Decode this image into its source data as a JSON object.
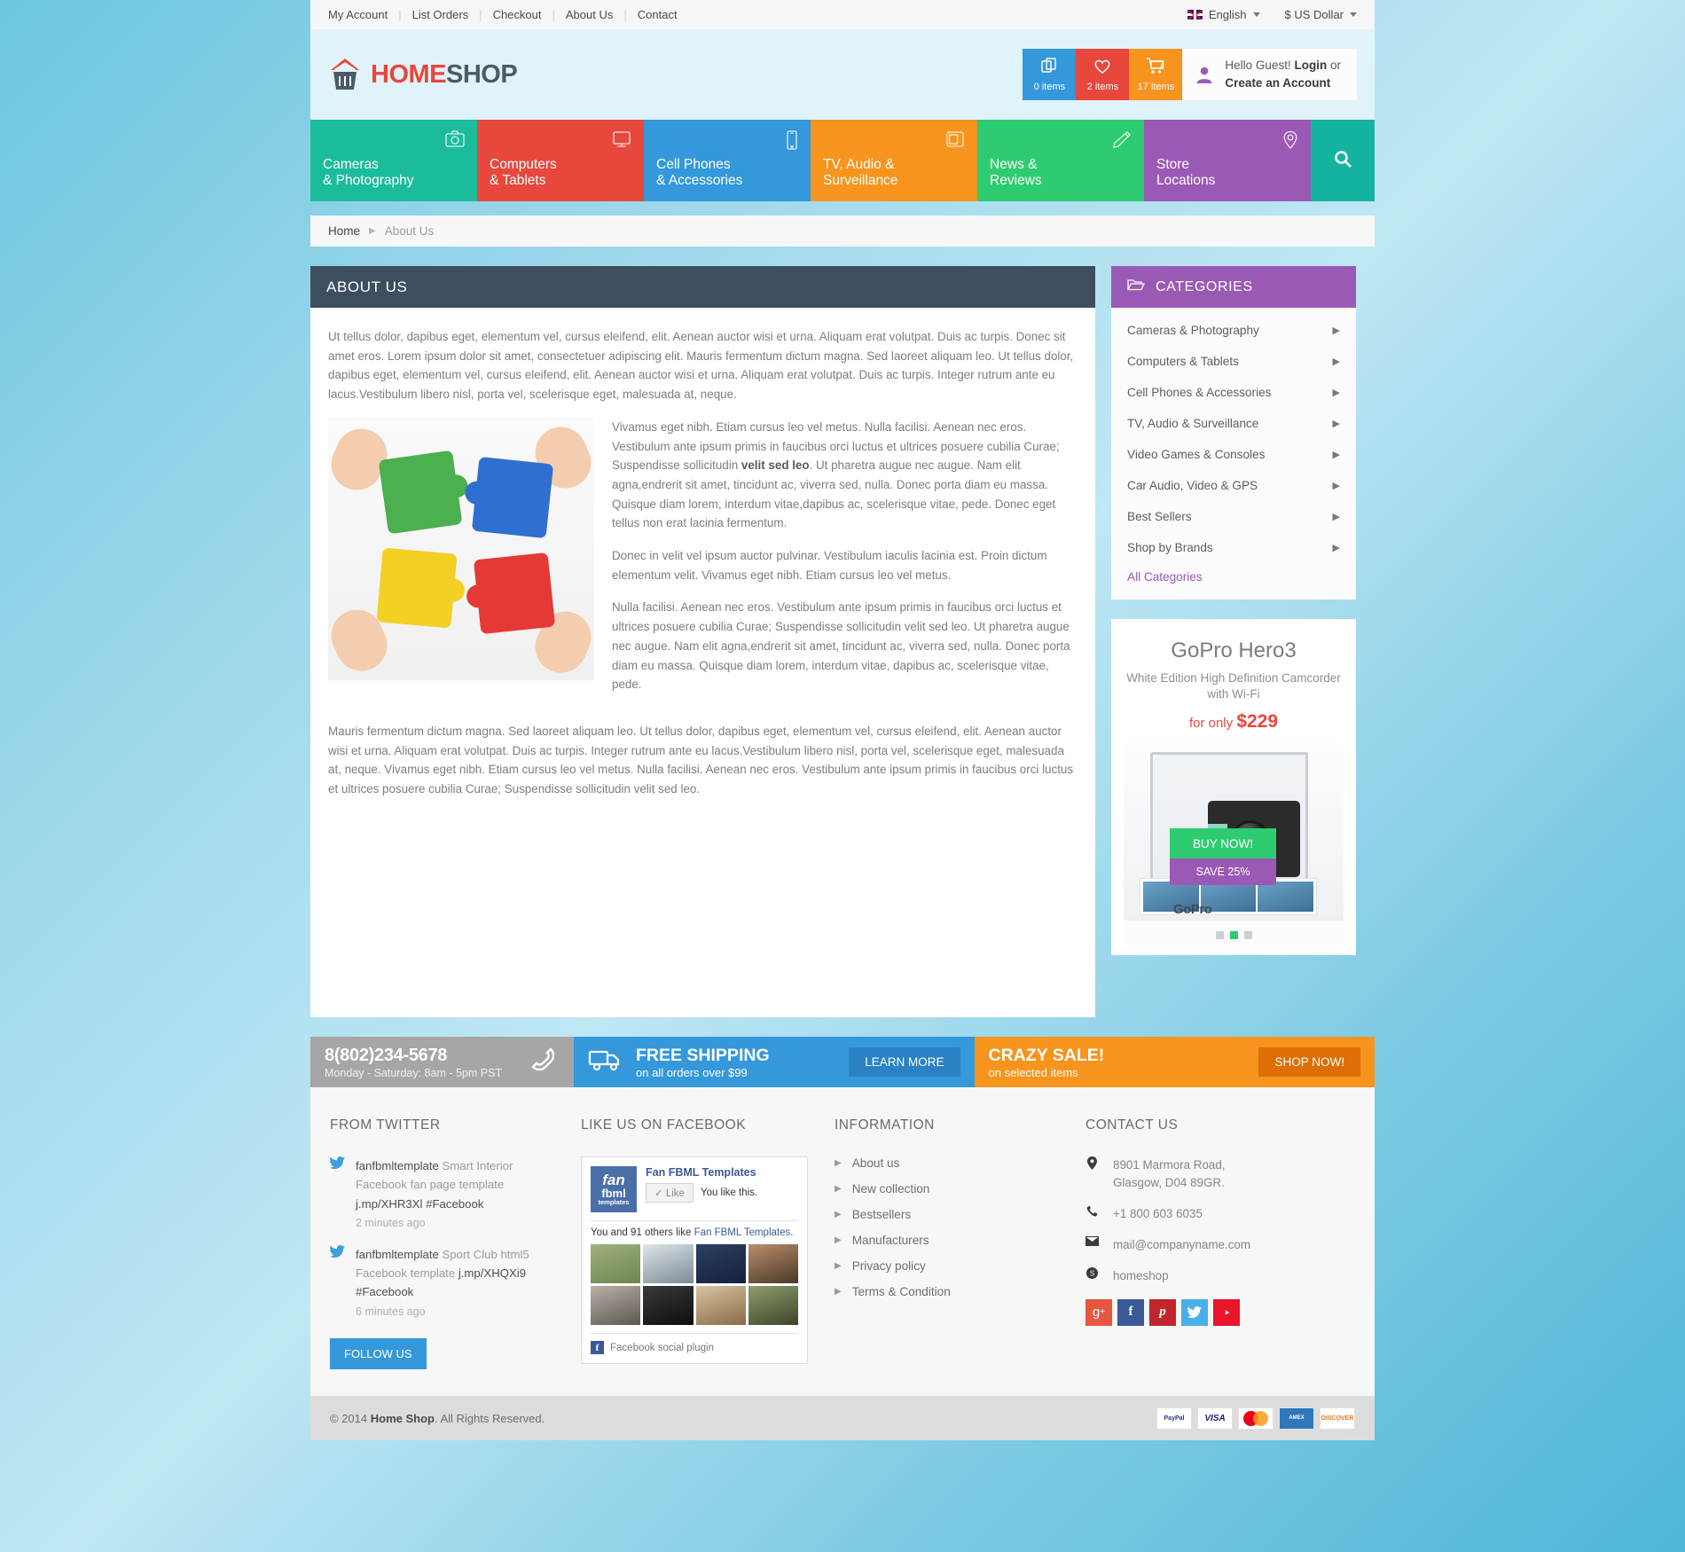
{
  "topbar": {
    "links": [
      "My Account",
      "List Orders",
      "Checkout",
      "About Us",
      "Contact"
    ],
    "language": "English",
    "currency": "$ US Dollar"
  },
  "header": {
    "logo_home": "HOME",
    "logo_shop": "SHOP",
    "tools": [
      {
        "icon": "compare-icon",
        "count": "0 items",
        "name": "compare"
      },
      {
        "icon": "heart-icon",
        "count": "2 items",
        "name": "wishlist"
      },
      {
        "icon": "cart-icon",
        "count": "17 items",
        "name": "cart"
      }
    ],
    "greeting": "Hello Guest!",
    "login": "Login",
    "or": " or",
    "create_account": "Create an Account"
  },
  "mainnav": {
    "items": [
      {
        "line1": "Cameras",
        "line2": "& Photography",
        "icon": "camera-icon",
        "color": "#1abc9c"
      },
      {
        "line1": "Computers",
        "line2": "& Tablets",
        "icon": "monitor-icon",
        "color": "#e8473c"
      },
      {
        "line1": "Cell Phones",
        "line2": "& Accessories",
        "icon": "phone-icon",
        "color": "#3498db"
      },
      {
        "line1": "TV, Audio &",
        "line2": "Surveillance",
        "icon": "tv-icon",
        "color": "#f7941e"
      },
      {
        "line1": "News &",
        "line2": "Reviews",
        "icon": "pencil-icon",
        "color": "#2ecc71"
      },
      {
        "line1": "Store",
        "line2": "Locations",
        "icon": "map-pin-icon",
        "color": "#9b59b6"
      }
    ],
    "search_icon": "search-icon"
  },
  "breadcrumb": {
    "home": "Home",
    "current": "About Us"
  },
  "main": {
    "title": "ABOUT US",
    "paragraph1": "Ut tellus dolor, dapibus eget, elementum vel, cursus eleifend, elit. Aenean auctor wisi et urna. Aliquam erat volutpat. Duis ac turpis. Donec sit amet eros. Lorem ipsum dolor sit amet, consectetuer adipiscing elit. Mauris fermentum dictum magna. Sed laoreet aliquam leo. Ut tellus dolor, dapibus eget, elementum vel, cursus eleifend, elit. Aenean auctor wisi et urna. Aliquam erat volutpat. Duis ac turpis. Integer rutrum ante eu lacus.Vestibulum libero nisl, porta vel, scelerisque eget, malesuada at, neque.",
    "paragraph2_a": "Vivamus eget nibh. Etiam cursus leo vel metus. Nulla facilisi. Aenean nec eros. Vestibulum ante ipsum primis in faucibus orci luctus et ultrices posuere cubilia Curae; Suspendisse sollicitudin ",
    "paragraph2_bold": "velit sed leo",
    "paragraph2_b": ". Ut pharetra augue nec augue. Nam elit agna,endrerit sit amet, tincidunt ac, viverra sed, nulla. Donec porta diam eu massa. Quisque diam lorem, interdum vitae,dapibus ac, scelerisque vitae, pede. Donec eget tellus non erat lacinia fermentum.",
    "paragraph3": "Donec in velit vel ipsum auctor pulvinar. Vestibulum iaculis lacinia est. Proin dictum elementum velit.  Vivamus eget nibh. Etiam cursus leo vel metus.",
    "paragraph4": "Nulla facilisi. Aenean nec eros. Vestibulum ante ipsum primis in faucibus orci luctus et ultrices posuere cubilia Curae; Suspendisse sollicitudin velit sed leo. Ut pharetra augue nec augue. Nam elit agna,endrerit sit amet, tincidunt ac, viverra sed, nulla. Donec porta diam eu massa. Quisque diam lorem, interdum vitae, dapibus ac, scelerisque vitae, pede.",
    "paragraph5": "Mauris fermentum dictum magna. Sed laoreet aliquam leo. Ut tellus dolor, dapibus eget, elementum vel, cursus eleifend, elit. Aenean auctor wisi et urna. Aliquam erat volutpat. Duis ac turpis. Integer rutrum ante eu lacus.Vestibulum libero nisl, porta vel, scelerisque eget, malesuada at, neque. Vivamus eget nibh. Etiam cursus leo vel metus. Nulla facilisi. Aenean nec eros. Vestibulum ante ipsum primis in faucibus orci luctus et ultrices posuere cubilia Curae; Suspendisse sollicitudin velit sed leo."
  },
  "sidebar": {
    "categories_title": "CATEGORIES",
    "categories": [
      "Cameras & Photography",
      "Computers & Tablets",
      "Cell Phones & Accessories",
      "TV, Audio & Surveillance",
      "Video Games & Consoles",
      "Car Audio, Video & GPS",
      "Best Sellers",
      "Shop by Brands"
    ],
    "all_categories": "All Categories",
    "promo": {
      "title": "GoPro Hero3",
      "subtitle": "White Edition High Definition Camcorder with Wi-Fi",
      "price_prefix": "for only ",
      "price": "$229",
      "buy_label": "BUY NOW!",
      "save_label": "SAVE 25%",
      "brand": "GoPro",
      "slides": 3,
      "active_slide": 1
    }
  },
  "strip": {
    "phone": "8(802)234-5678",
    "hours": "Monday - Saturday: 8am - 5pm PST",
    "shipping_title": "FREE SHIPPING",
    "shipping_sub": "on all orders over $99",
    "learn_more": "LEARN MORE",
    "sale_title": "CRAZY SALE!",
    "sale_sub": "on selected items",
    "shop_now": "SHOP NOW!"
  },
  "footer": {
    "twitter": {
      "title": "FROM TWITTER",
      "tweets": [
        {
          "user": "fanfbmltemplate",
          "text": " Smart Interior Facebook fan page template ",
          "link": "j.mp/XHR3Xl #Facebook",
          "time": "2 minutes ago"
        },
        {
          "user": "fanfbmltemplate",
          "text": " Sport Club html5 Facebook template ",
          "link": "j.mp/XHQXi9 #Facebook",
          "time": "6 minutes ago"
        }
      ],
      "follow_label": "FOLLOW US"
    },
    "facebook": {
      "title": "LIKE US ON FACEBOOK",
      "page_name": "Fan FBML Templates",
      "logo_l1": "fan",
      "logo_l2": "fbml",
      "logo_l3": "templates",
      "like_button": "Like",
      "like_status": "You like this.",
      "count_prefix": "You and 91 others like ",
      "count_link": "Fan FBML Templates.",
      "plugin_label": "Facebook social plugin",
      "face_count": 8
    },
    "information": {
      "title": "INFORMATION",
      "items": [
        "About us",
        "New collection",
        "Bestsellers",
        "Manufacturers",
        "Privacy policy",
        "Terms & Condition"
      ]
    },
    "contact": {
      "title": "CONTACT US",
      "address_line1": "8901 Marmora Road,",
      "address_line2": "Glasgow, D04 89GR.",
      "phone": "+1 800 603 6035",
      "email": "mail@companyname.com",
      "skype": "homeshop",
      "social": [
        {
          "name": "google-plus",
          "glyph": "g+",
          "color": "#e8563f"
        },
        {
          "name": "facebook",
          "glyph": "f",
          "color": "#3b5998"
        },
        {
          "name": "pinterest",
          "glyph": "p",
          "color": "#c0262c"
        },
        {
          "name": "twitter",
          "glyph": "t",
          "color": "#4aaeea"
        },
        {
          "name": "youtube",
          "glyph": "y",
          "color": "#e8152b"
        }
      ]
    }
  },
  "copyright": {
    "prefix": "© 2014 ",
    "brand": "Home Shop",
    "suffix": ". All Rights Reserved.",
    "cards": [
      "PayPal",
      "VISA",
      "MasterCard",
      "AMEX",
      "DISCOVER"
    ]
  }
}
